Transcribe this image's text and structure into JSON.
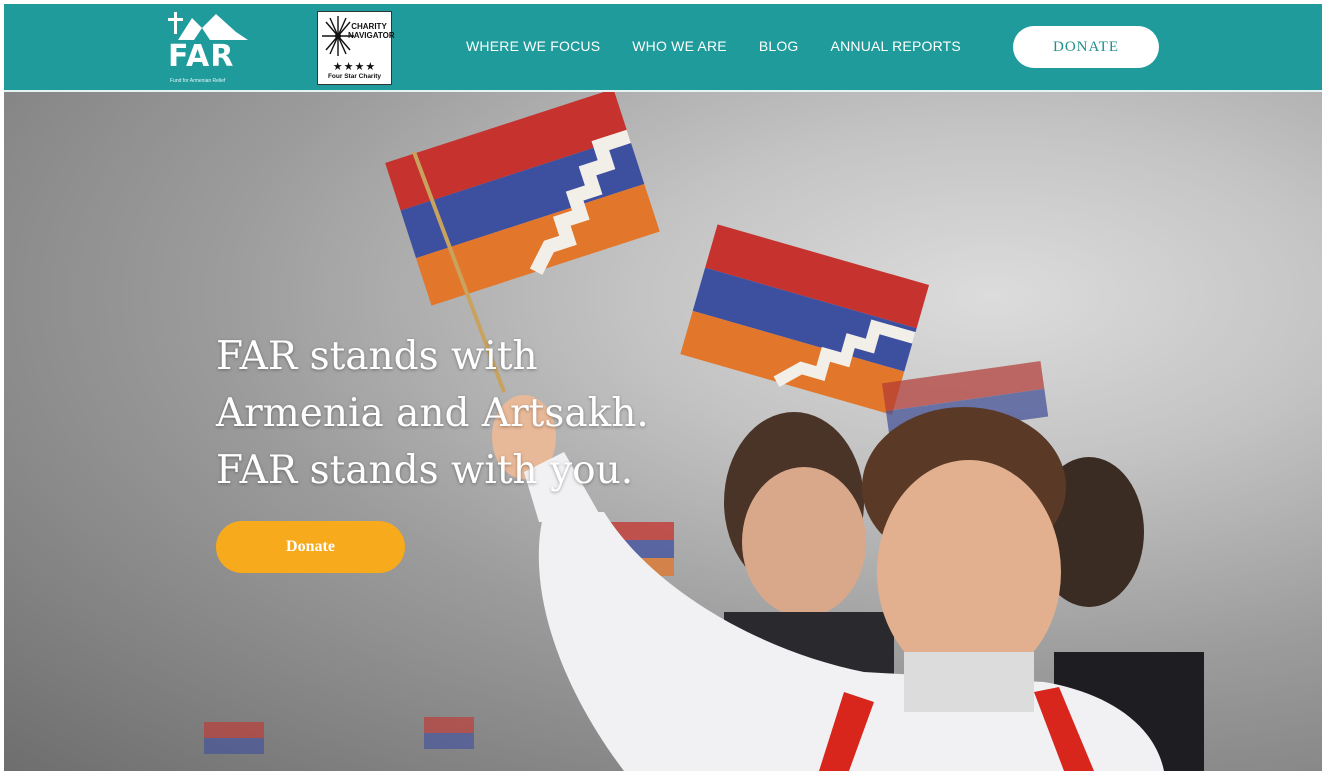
{
  "header": {
    "logo": {
      "text": "FAR",
      "subtitle": "Fund for Armenian Relief"
    },
    "charity_badge": {
      "line1": "CHARITY",
      "line2": "NAVIGATOR",
      "stars": "★★★★",
      "rating": "Four Star Charity"
    },
    "nav": [
      {
        "label": "WHERE WE FOCUS"
      },
      {
        "label": "WHO WE ARE"
      },
      {
        "label": "BLOG"
      },
      {
        "label": "ANNUAL REPORTS"
      }
    ],
    "donate_label": "DONATE"
  },
  "hero": {
    "headline": [
      "FAR stands with",
      "Armenia and Artsakh.",
      "FAR stands with you."
    ],
    "donate_label": "Donate"
  },
  "colors": {
    "header_bg": "#1f9b9b",
    "donate_accent": "#f6aa1c",
    "white": "#ffffff"
  }
}
